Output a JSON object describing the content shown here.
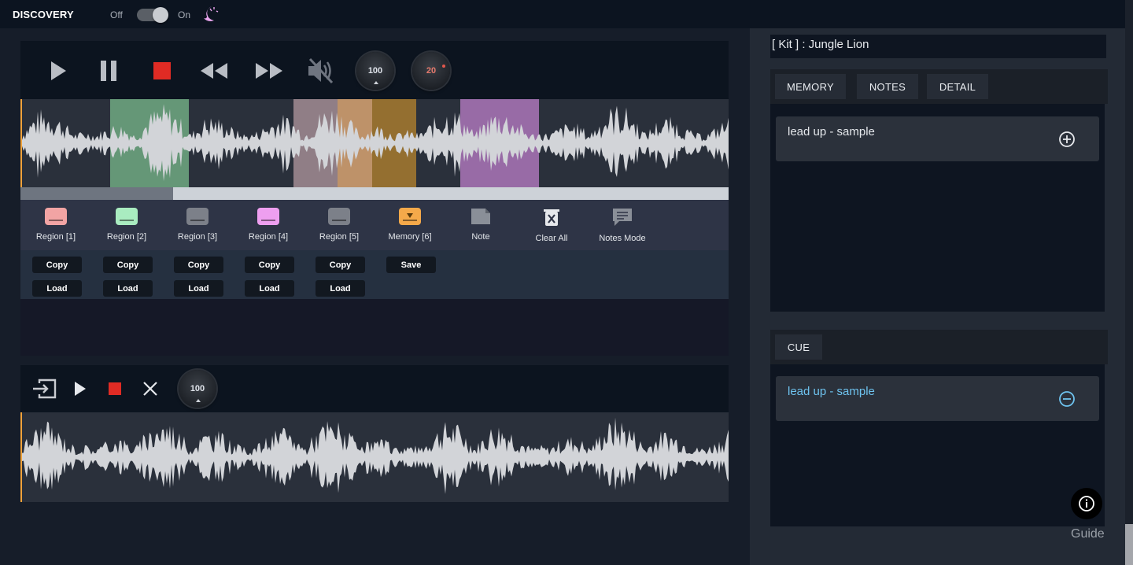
{
  "app": {
    "title": "DISCOVERY",
    "toggle": {
      "off_label": "Off",
      "on_label": "On",
      "state": "on"
    }
  },
  "deck1": {
    "tempo_knob": "100",
    "pitch_knob": "20",
    "progress_fraction": 0.216,
    "regions": [
      {
        "label": "Region [1]",
        "color": "#f2a4a4"
      },
      {
        "label": "Region [2]",
        "color": "#a9ecc0"
      },
      {
        "label": "Region [3]",
        "color": "#7c8089"
      },
      {
        "label": "Region [4]",
        "color": "#ee9ff0"
      },
      {
        "label": "Region [5]",
        "color": "#7c8089"
      },
      {
        "label": "Memory [6]",
        "color": "#f5a94a"
      }
    ],
    "tools": [
      {
        "label": "Note"
      },
      {
        "label": "Clear All"
      },
      {
        "label": "Notes Mode"
      }
    ],
    "copy_label": "Copy",
    "load_label": "Load",
    "save_label": "Save",
    "region_overlays": [
      {
        "color": "#7fc391",
        "opacity": 0.7
      },
      {
        "color": "#e3bfc4",
        "opacity": 0.55
      },
      {
        "color": "#f0b37a",
        "opacity": 0.75
      },
      {
        "color": "#a77a2f",
        "opacity": 0.85
      },
      {
        "color": "#c785d4",
        "opacity": 0.7
      }
    ]
  },
  "deck2": {
    "tempo_knob": "100"
  },
  "sidebar": {
    "kit_title": "[ Kit ] : Jungle Lion",
    "tabs": [
      {
        "label": "MEMORY"
      },
      {
        "label": "NOTES"
      },
      {
        "label": "DETAIL"
      }
    ],
    "memory_entries": [
      {
        "label": "lead up - sample",
        "action": "add"
      }
    ],
    "cue_tab": "CUE",
    "cue_entries": [
      {
        "label": "lead up - sample",
        "action": "remove"
      }
    ],
    "guide_label": "Guide"
  },
  "colors": {
    "accent_cue": "#6ec3ef",
    "stop_red": "#e02b24",
    "playhead": "#f0a23a"
  }
}
